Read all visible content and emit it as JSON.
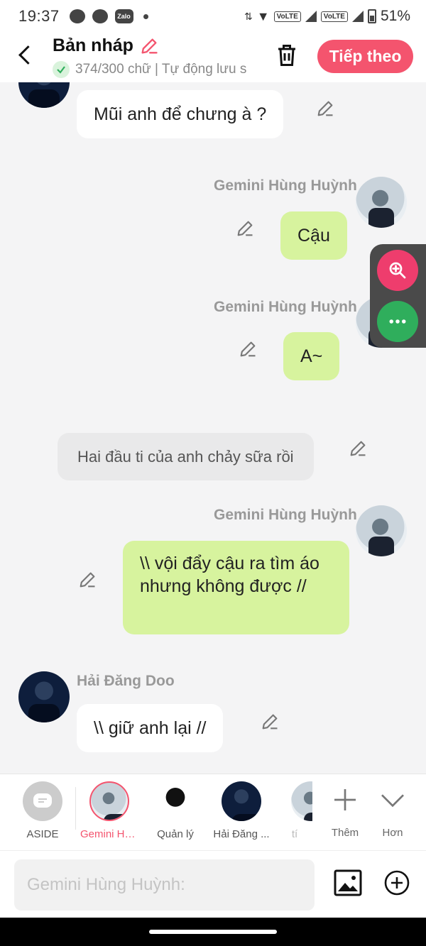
{
  "status_bar": {
    "time": "19:37",
    "battery": "51%",
    "volte_1": "VoLTE",
    "volte_2": "VoLTE",
    "zalo_label": "Zalo"
  },
  "header": {
    "title": "Bản nháp",
    "subtitle": "374/300 chữ | Tự động lưu s",
    "next_button": "Tiếp theo"
  },
  "messages": [
    {
      "side": "left",
      "avatar": "dark",
      "text": "Mũi anh để chưng à ?"
    },
    {
      "side": "right",
      "name": "Gemini Hùng Huỳnh",
      "text": "Cậu"
    },
    {
      "side": "right",
      "name": "Gemini Hùng Huỳnh",
      "text": "A~"
    },
    {
      "side": "aside",
      "text": "Hai đầu ti của anh chảy sữa rồi"
    },
    {
      "side": "right",
      "name": "Gemini Hùng Huỳnh",
      "text": "\\\\ vội đẩy cậu ra tìm áo nhưng không được //"
    },
    {
      "side": "left",
      "name": "Hải Đăng Doo",
      "text": "\\\\ giữ anh lại //"
    }
  ],
  "characters": [
    {
      "label": "ASIDE"
    },
    {
      "label": "Gemini Hù..."
    },
    {
      "label": "Quản lý"
    },
    {
      "label": "Hải Đăng ..."
    },
    {
      "label": "tí"
    }
  ],
  "tools": {
    "add_label": "Thêm",
    "more_label": "Hơn"
  },
  "composer": {
    "placeholder": "Gemini Hùng Huỳnh:"
  },
  "colors": {
    "accent": "#f4546e",
    "my_bubble": "#d7f39e",
    "zoom_button": "#ee3d6d",
    "more_button": "#2fae5c"
  }
}
